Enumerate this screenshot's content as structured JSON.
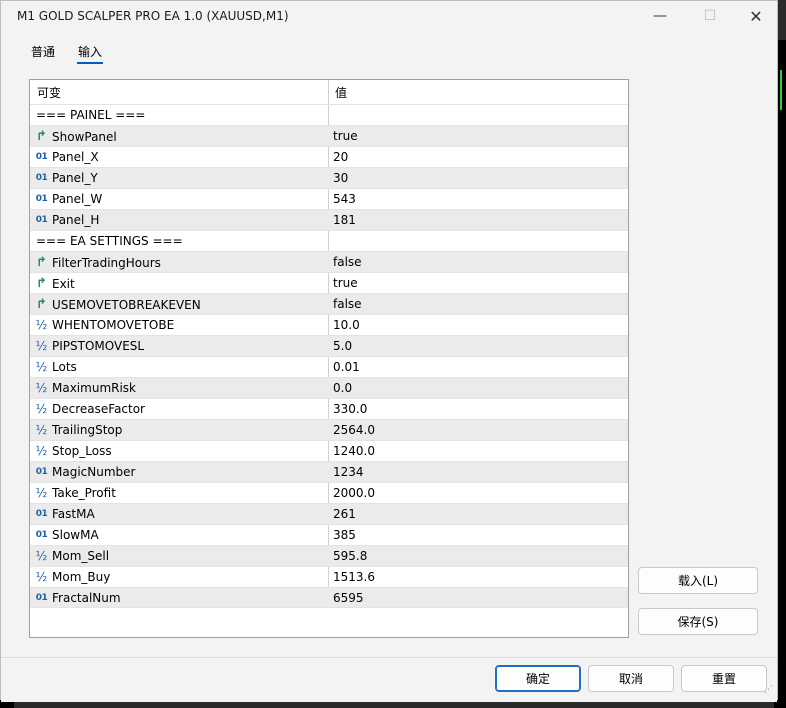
{
  "window": {
    "title": "M1 GOLD SCALPER PRO EA 1.0 (XAUUSD,M1)",
    "minimize_icon": "minimize-icon",
    "maximize_icon": "maximize-icon",
    "close_icon": "close-icon"
  },
  "tabs": [
    {
      "label": "普通",
      "active": false
    },
    {
      "label": "输入",
      "active": true
    }
  ],
  "table": {
    "columns": [
      "可变",
      "值"
    ],
    "rows": [
      {
        "type": "section",
        "name": "=== PAINEL ===",
        "value": ""
      },
      {
        "type": "bool",
        "name": "ShowPanel",
        "value": "true"
      },
      {
        "type": "int",
        "name": "Panel_X",
        "value": "20"
      },
      {
        "type": "int",
        "name": "Panel_Y",
        "value": "30"
      },
      {
        "type": "int",
        "name": "Panel_W",
        "value": "543"
      },
      {
        "type": "int",
        "name": "Panel_H",
        "value": "181"
      },
      {
        "type": "section",
        "name": "=== EA SETTINGS ===",
        "value": ""
      },
      {
        "type": "bool",
        "name": "FilterTradingHours",
        "value": "false"
      },
      {
        "type": "bool",
        "name": "Exit",
        "value": "true"
      },
      {
        "type": "bool",
        "name": "USEMOVETOBREAKEVEN",
        "value": "false"
      },
      {
        "type": "double",
        "name": "WHENTOMOVETOBE",
        "value": "10.0"
      },
      {
        "type": "double",
        "name": "PIPSTOMOVESL",
        "value": "5.0"
      },
      {
        "type": "double",
        "name": "Lots",
        "value": "0.01"
      },
      {
        "type": "double",
        "name": "MaximumRisk",
        "value": "0.0"
      },
      {
        "type": "double",
        "name": "DecreaseFactor",
        "value": "330.0"
      },
      {
        "type": "double",
        "name": "TrailingStop",
        "value": "2564.0"
      },
      {
        "type": "double",
        "name": "Stop_Loss",
        "value": "1240.0"
      },
      {
        "type": "int",
        "name": "MagicNumber",
        "value": "1234"
      },
      {
        "type": "double",
        "name": "Take_Profit",
        "value": "2000.0"
      },
      {
        "type": "int",
        "name": "FastMA",
        "value": "261"
      },
      {
        "type": "int",
        "name": "SlowMA",
        "value": "385"
      },
      {
        "type": "double",
        "name": "Mom_Sell",
        "value": "595.8"
      },
      {
        "type": "double",
        "name": "Mom_Buy",
        "value": "1513.6"
      },
      {
        "type": "int",
        "name": "FractalNum",
        "value": "6595"
      }
    ]
  },
  "icons": {
    "bool": {
      "glyph": "↱",
      "name": "bool-type-icon"
    },
    "int": {
      "glyph": "01",
      "name": "int-type-icon"
    },
    "double": {
      "glyph": "½",
      "name": "double-type-icon"
    }
  },
  "side_buttons": {
    "load": "载入(L)",
    "save": "保存(S)"
  },
  "footer": {
    "ok": "确定",
    "cancel": "取消",
    "reset": "重置"
  },
  "colors": {
    "accent": "#005fb8",
    "alt_row": "#ebebeb",
    "bool_icon": "#2e8b57",
    "num_icon": "#1f5fa8"
  }
}
